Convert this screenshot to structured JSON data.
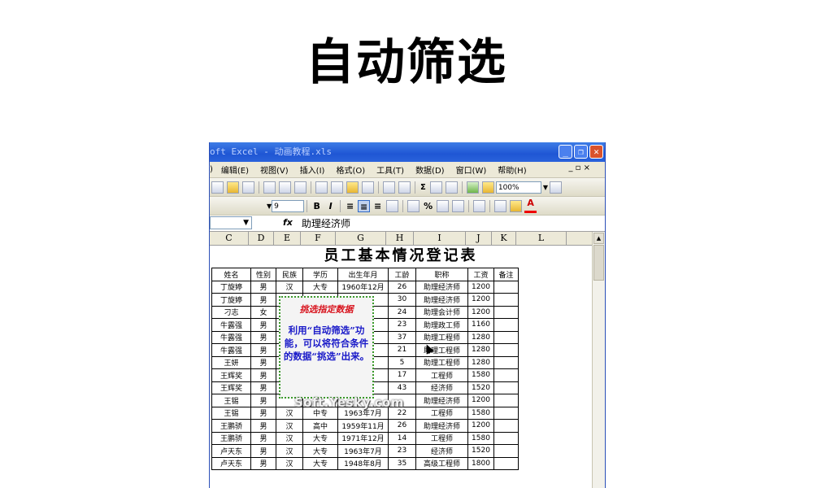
{
  "slide": {
    "title": "自动筛选"
  },
  "window": {
    "title": "oft Excel - 动画教程.xls",
    "buttons": [
      "_",
      "❐",
      "✕"
    ]
  },
  "menu": {
    "items": [
      ")",
      "编辑(E)",
      "视图(V)",
      "插入(I)",
      "格式(O)",
      "工具(T)",
      "数据(D)",
      "窗口(W)",
      "帮助(H)"
    ],
    "window_controls": "_ ▫ ×"
  },
  "toolbar": {
    "zoom": "100%",
    "sigma": "Σ"
  },
  "format_toolbar": {
    "font_size": "9",
    "bold": "B",
    "italic": "I",
    "percent": "%"
  },
  "formula_bar": {
    "fx": "fx",
    "value": "助理经济师"
  },
  "columns": [
    "C",
    "D",
    "E",
    "F",
    "G",
    "H",
    "I",
    "J",
    "K",
    "L"
  ],
  "sheet": {
    "title": "员工基本情况登记表",
    "headers": [
      "姓名",
      "性别",
      "民族",
      "学历",
      "出生年月",
      "工龄",
      "职称",
      "工资",
      "备注"
    ],
    "rows": [
      [
        "丁旋婷",
        "男",
        "汉",
        "大专",
        "1960年12月",
        "26",
        "助理经济师",
        "1200",
        ""
      ],
      [
        "丁旋婷",
        "男",
        "",
        "",
        "月",
        "30",
        "助理经济师",
        "1200",
        ""
      ],
      [
        "刁志",
        "女",
        "",
        "",
        "月",
        "24",
        "助理会计师",
        "1200",
        ""
      ],
      [
        "牛露强",
        "男",
        "",
        "",
        "月",
        "23",
        "助理政工师",
        "1160",
        ""
      ],
      [
        "牛露强",
        "男",
        "",
        "",
        "月",
        "37",
        "助理工程师",
        "1280",
        ""
      ],
      [
        "牛露强",
        "男",
        "",
        "",
        "月",
        "21",
        "助理工程师",
        "1280",
        ""
      ],
      [
        "王妍",
        "男",
        "",
        "",
        "月",
        "5",
        "助理工程师",
        "1280",
        ""
      ],
      [
        "王辉奖",
        "男",
        "",
        "",
        "月",
        "17",
        "工程师",
        "1580",
        ""
      ],
      [
        "王辉奖",
        "男",
        "",
        "",
        "月",
        "43",
        "经济师",
        "1520",
        ""
      ],
      [
        "王锡",
        "男",
        "",
        "",
        "",
        "",
        "助理经济师",
        "1200",
        ""
      ],
      [
        "王锡",
        "男",
        "汉",
        "中专",
        "1963年7月",
        "22",
        "工程师",
        "1580",
        ""
      ],
      [
        "王鹏骄",
        "男",
        "汉",
        "高中",
        "1959年11月",
        "26",
        "助理经济师",
        "1200",
        ""
      ],
      [
        "王鹏骄",
        "男",
        "汉",
        "大专",
        "1971年12月",
        "14",
        "工程师",
        "1580",
        ""
      ],
      [
        "卢天东",
        "男",
        "汉",
        "大专",
        "1963年7月",
        "23",
        "经济师",
        "1520",
        ""
      ],
      [
        "卢天东",
        "男",
        "汉",
        "大专",
        "1948年8月",
        "35",
        "高级工程师",
        "1800",
        ""
      ]
    ]
  },
  "popup": {
    "heading": "挑选指定数据",
    "body": "利用“自动筛选”功能，可以将符合条件的数据“挑选”出来。"
  },
  "watermark": "Soft.Yesky.com"
}
